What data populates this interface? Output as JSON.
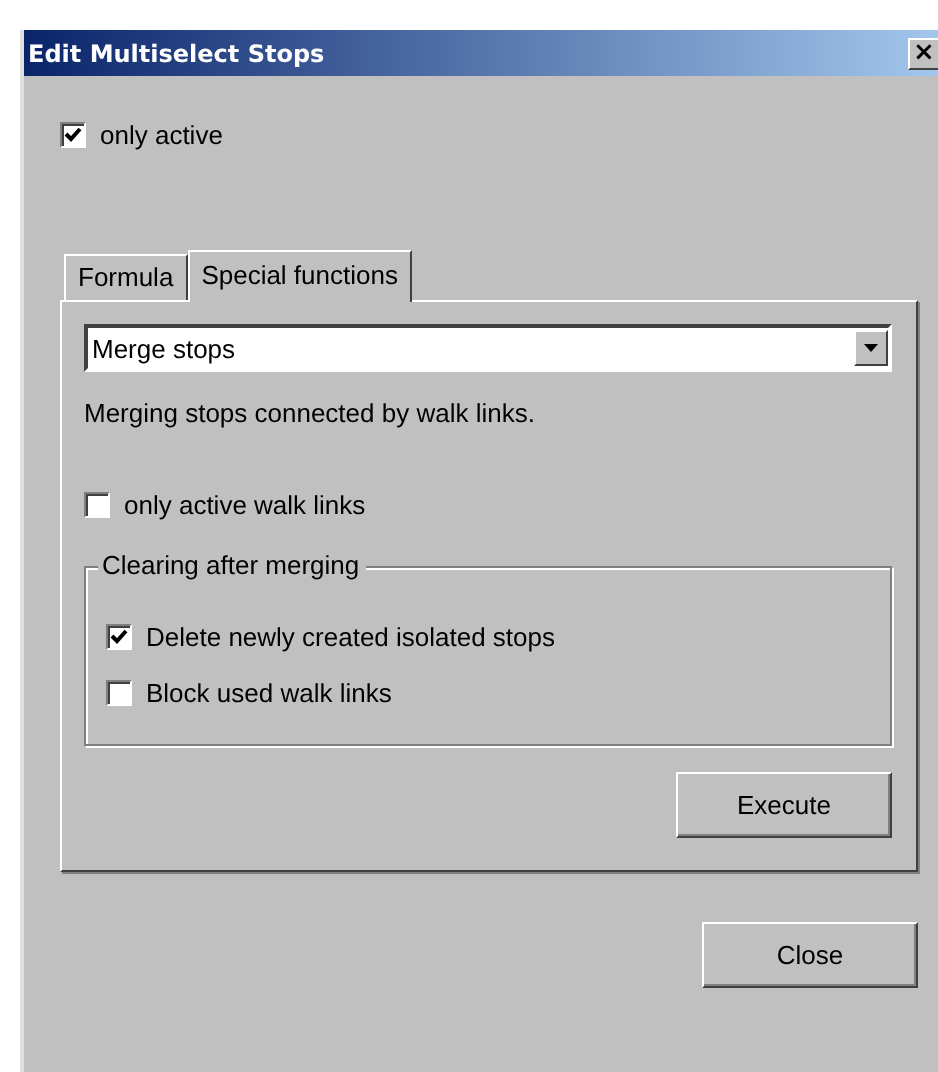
{
  "window": {
    "title": "Edit Multiselect Stops",
    "close": "×"
  },
  "only_active": {
    "label": "only active",
    "checked": true
  },
  "tabs": [
    {
      "label": "Formula",
      "selected": false
    },
    {
      "label": "Special functions",
      "selected": true
    }
  ],
  "function_select": {
    "value": "Merge stops"
  },
  "description": "Merging stops connected by walk links.",
  "only_active_walk_links": {
    "label": "only active walk links",
    "checked": false
  },
  "clearing_group": {
    "title": "Clearing after merging",
    "options": [
      {
        "label": "Delete newly created isolated stops",
        "checked": true
      },
      {
        "label": "Block used walk links",
        "checked": false
      }
    ]
  },
  "execute_button": "Execute",
  "close_button": "Close"
}
